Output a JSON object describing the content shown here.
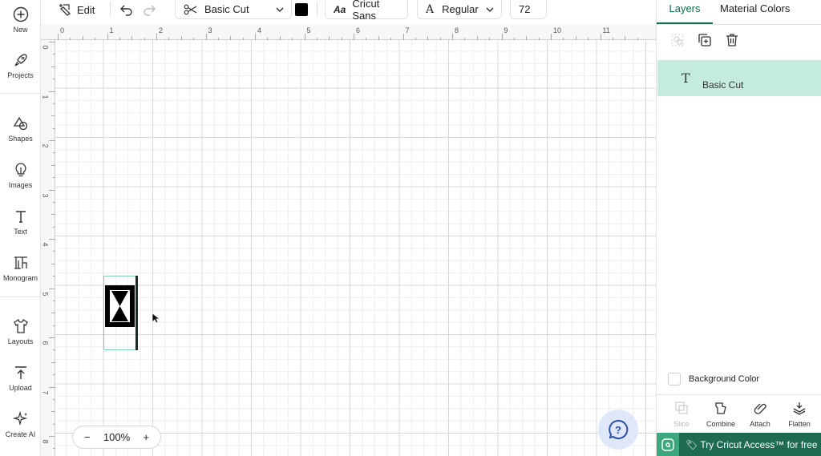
{
  "sidebar": {
    "items": [
      {
        "label": "New",
        "icon": "plus-circle-icon"
      },
      {
        "label": "Projects",
        "icon": "rocket-icon"
      },
      {
        "label": "Shapes",
        "icon": "shapes-icon"
      },
      {
        "label": "Images",
        "icon": "lightbulb-icon"
      },
      {
        "label": "Text",
        "icon": "text-icon"
      },
      {
        "label": "Monogram",
        "icon": "monogram-icon"
      },
      {
        "label": "Layouts",
        "icon": "shirt-icon"
      },
      {
        "label": "Upload",
        "icon": "upload-icon"
      },
      {
        "label": "Create AI",
        "icon": "sparkle-icon"
      }
    ]
  },
  "toolbar": {
    "edit_label": "Edit",
    "operation": "Basic Cut",
    "color": "#000000",
    "font_prefix": "Aa",
    "font_name": "Cricut Sans",
    "style_prefix": "A",
    "style": "Regular",
    "font_size": "72"
  },
  "ruler": {
    "top": [
      "0",
      "1",
      "2",
      "3",
      "4",
      "5",
      "6",
      "7",
      "8",
      "9",
      "10",
      "11"
    ],
    "left": [
      "0",
      "1",
      "2",
      "3",
      "4",
      "5",
      "6",
      "7",
      "8"
    ]
  },
  "canvas": {
    "zoom_minus": "−",
    "zoom_level": "100%",
    "zoom_plus": "+",
    "help_label": "?"
  },
  "panel": {
    "tabs": [
      {
        "label": "Layers",
        "active": true
      },
      {
        "label": "Material Colors",
        "active": false
      }
    ],
    "layers": [
      {
        "type_icon": "T",
        "name": "Basic Cut"
      }
    ],
    "background_color_label": "Background Color",
    "actions": [
      {
        "label": "Slice",
        "icon": "slice-icon",
        "enabled": false
      },
      {
        "label": "Combine",
        "icon": "combine-icon",
        "enabled": true
      },
      {
        "label": "Attach",
        "icon": "attach-icon",
        "enabled": true
      },
      {
        "label": "Flatten",
        "icon": "flatten-icon",
        "enabled": true
      }
    ],
    "promo_text": "🏷 Try Cricut Access™ for free"
  },
  "colors": {
    "accent": "#0e6e50",
    "layer_highlight": "#c5ebdf",
    "promo_bg": "#1f6a52"
  }
}
